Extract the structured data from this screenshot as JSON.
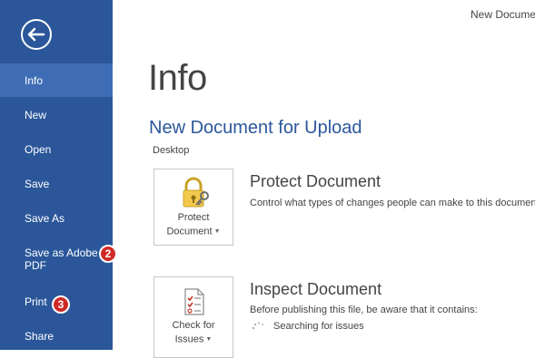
{
  "window": {
    "title": "New Document"
  },
  "sidebar": {
    "back_icon": "back-arrow-icon",
    "items": [
      {
        "label": "Info",
        "active": true
      },
      {
        "label": "New"
      },
      {
        "label": "Open"
      },
      {
        "label": "Save"
      },
      {
        "label": "Save As"
      },
      {
        "label": "Save as Adobe PDF",
        "badge": "2"
      },
      {
        "label": "Print",
        "badge": "3"
      },
      {
        "label": "Share"
      }
    ]
  },
  "main": {
    "page_title": "Info",
    "document_title": "New Document for Upload",
    "document_location": "Desktop",
    "sections": [
      {
        "tile_label_line1": "Protect",
        "tile_label_line2": "Document",
        "tile_icon": "lock-key-icon",
        "title": "Protect Document",
        "description": "Control what types of changes people can make to this document."
      },
      {
        "tile_label_line1": "Check for",
        "tile_label_line2": "Issues",
        "tile_icon": "checklist-icon",
        "title": "Inspect Document",
        "description": "Before publishing this file, be aware that it contains:",
        "status": "Searching for issues"
      }
    ]
  },
  "colors": {
    "sidebar": "#2b579a",
    "sidebar_active": "#3e6db5",
    "accent_title": "#2b579a",
    "badge": "#cf2a27"
  }
}
